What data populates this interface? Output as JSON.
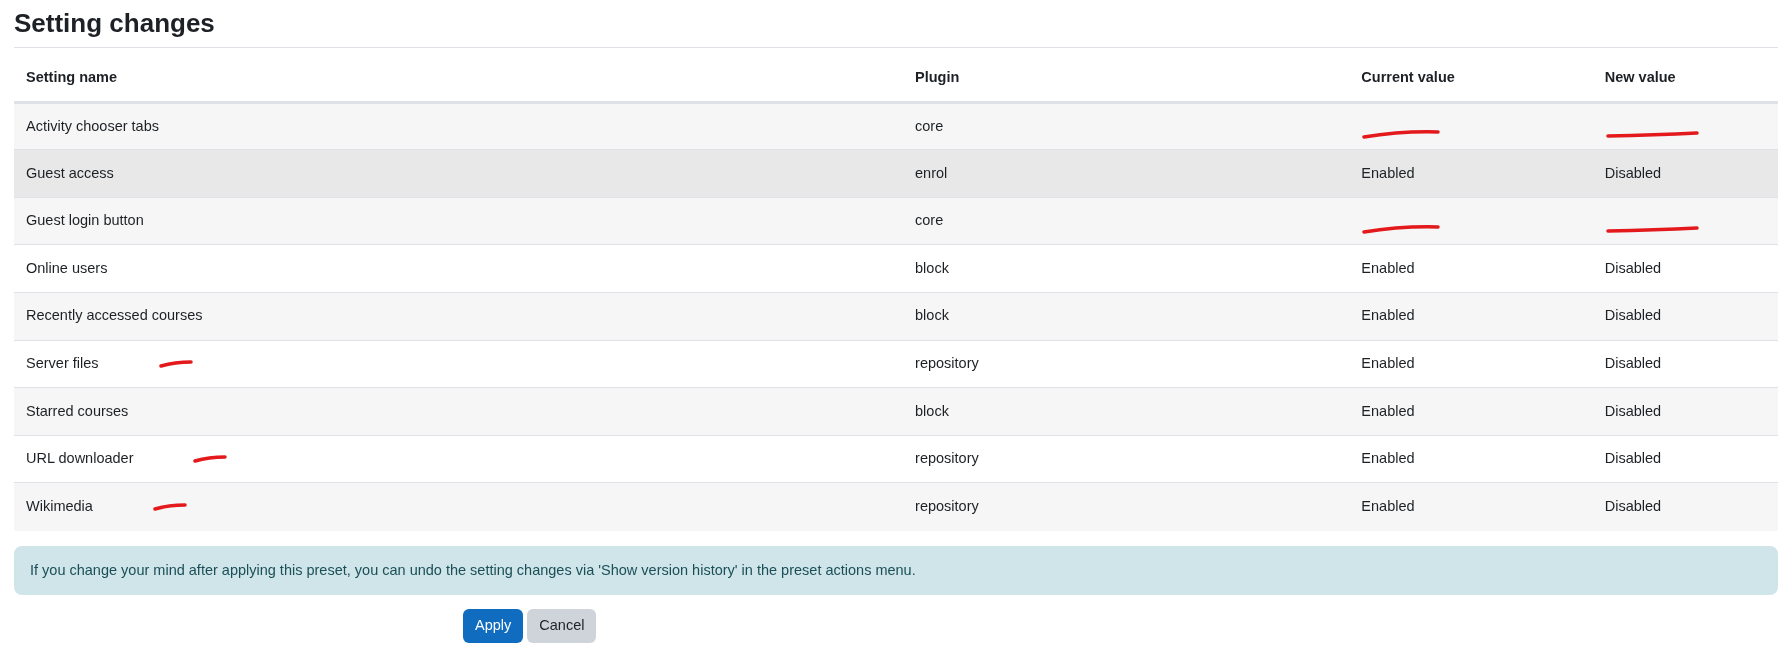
{
  "title": "Setting changes",
  "table": {
    "columns": [
      "Setting name",
      "Plugin",
      "Current value",
      "New value"
    ],
    "rows": [
      {
        "name": "Activity chooser tabs",
        "plugin": "core",
        "highlighted": false,
        "scribble_name": false,
        "scribble_values": true
      },
      {
        "name": "Guest access",
        "plugin": "enrol",
        "current": "Enabled",
        "new": "Disabled",
        "highlighted": true,
        "scribble_name": false,
        "scribble_values": false
      },
      {
        "name": "Guest login button",
        "plugin": "core",
        "highlighted": false,
        "scribble_name": false,
        "scribble_values": true
      },
      {
        "name": "Online users",
        "plugin": "block",
        "current": "Enabled",
        "new": "Disabled",
        "highlighted": false,
        "scribble_name": false,
        "scribble_values": false
      },
      {
        "name": "Recently accessed courses",
        "plugin": "block",
        "current": "Enabled",
        "new": "Disabled",
        "highlighted": false,
        "scribble_name": false,
        "scribble_values": false
      },
      {
        "name": "Server files",
        "plugin": "repository",
        "current": "Enabled",
        "new": "Disabled",
        "highlighted": false,
        "scribble_name": true,
        "scribble_values": false
      },
      {
        "name": "Starred courses",
        "plugin": "block",
        "current": "Enabled",
        "new": "Disabled",
        "highlighted": false,
        "scribble_name": false,
        "scribble_values": false
      },
      {
        "name": "URL downloader",
        "plugin": "repository",
        "current": "Enabled",
        "new": "Disabled",
        "highlighted": false,
        "scribble_name": true,
        "scribble_values": false
      },
      {
        "name": "Wikimedia",
        "plugin": "repository",
        "current": "Enabled",
        "new": "Disabled",
        "highlighted": false,
        "scribble_name": true,
        "scribble_values": false
      }
    ]
  },
  "notice": "If you change your mind after applying this preset, you can undo the setting changes via 'Show version history' in the preset actions menu.",
  "buttons": [
    {
      "label": "Apply",
      "kind": "primary"
    },
    {
      "label": "Cancel",
      "kind": "secondary"
    }
  ]
}
